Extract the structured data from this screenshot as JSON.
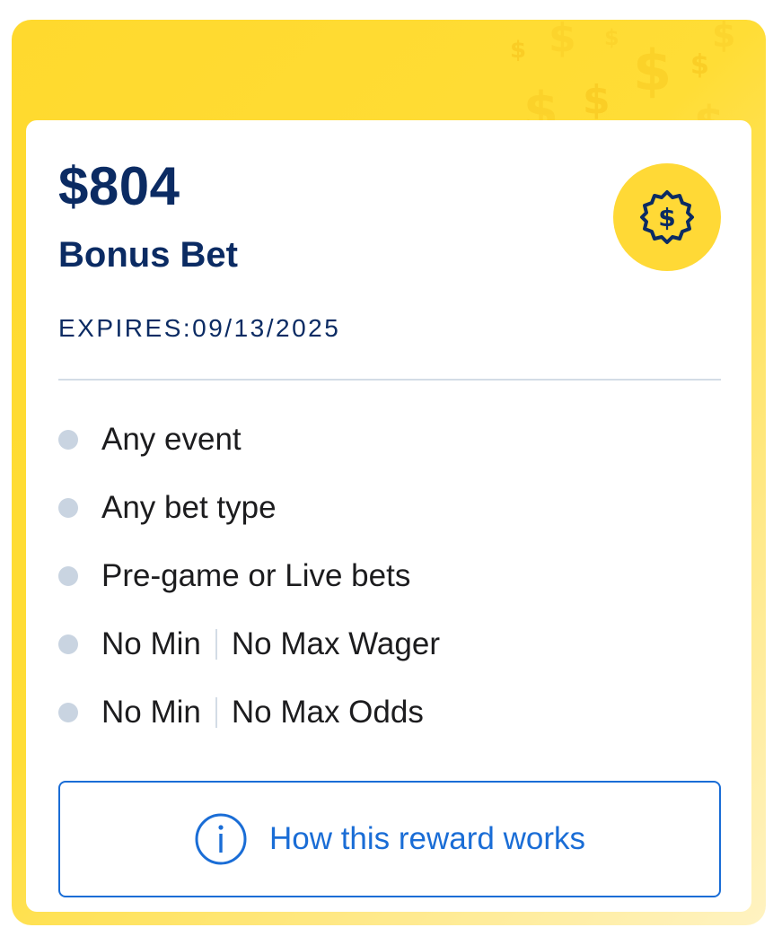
{
  "colors": {
    "frame_yellow": "#FFD92E",
    "navy": "#0B2B63",
    "link_blue": "#1A6DD6",
    "bullet_gray": "#C9D4E1"
  },
  "reward": {
    "amount": "$804",
    "type": "Bonus Bet",
    "expires": "EXPIRES:09/13/2025",
    "badge_icon": "dollar-badge-icon"
  },
  "terms": [
    {
      "text": "Any event"
    },
    {
      "text": "Any bet type"
    },
    {
      "text": "Pre-game or Live bets"
    },
    {
      "left": "No Min",
      "right": "No Max Wager"
    },
    {
      "left": "No Min",
      "right": "No Max Odds"
    }
  ],
  "how_button": {
    "label": "How this reward works",
    "icon": "info-icon"
  }
}
